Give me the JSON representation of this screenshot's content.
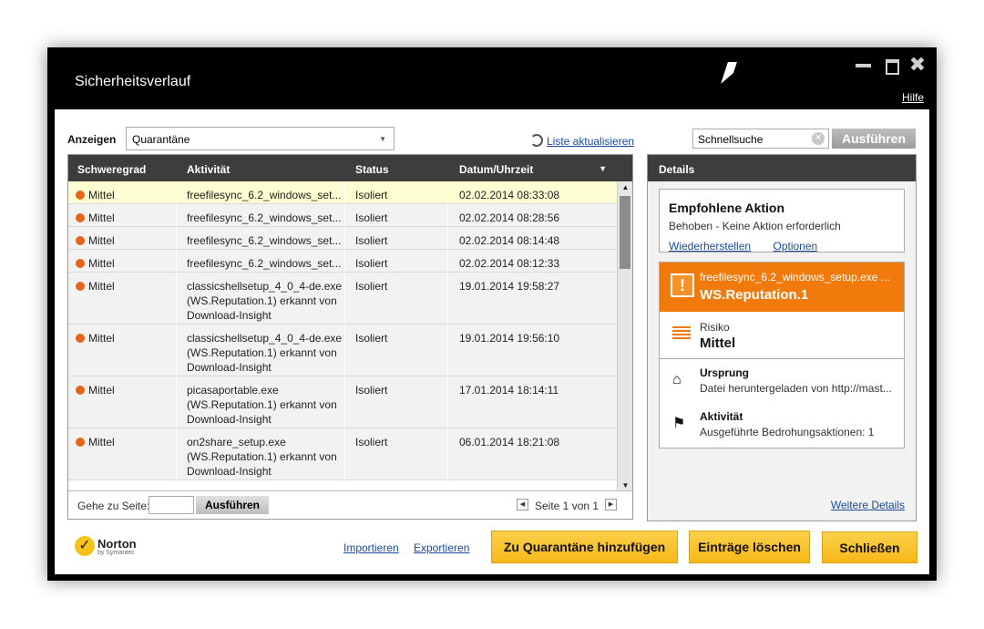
{
  "window": {
    "title": "Sicherheitsverlauf",
    "close_glyph": "✖",
    "help_label": "Hilfe"
  },
  "toolbar": {
    "show_label": "Anzeigen",
    "show_value": "Quarantäne",
    "dropdown_glyph": "▼",
    "refresh_label": "Liste aktualisieren",
    "search_placeholder": "Schnellsuche",
    "search_clear_glyph": "✕",
    "search_button": "Ausführen"
  },
  "table": {
    "columns": [
      "Schweregrad",
      "Aktivität",
      "Status",
      "Datum/Uhrzeit"
    ],
    "sort_glyph": "▼",
    "rows": [
      {
        "severity": "Mittel",
        "activity": [
          "freefilesync_6.2_windows_set..."
        ],
        "status": "Isoliert",
        "datetime": "02.02.2014 08:33:08"
      },
      {
        "severity": "Mittel",
        "activity": [
          "freefilesync_6.2_windows_set..."
        ],
        "status": "Isoliert",
        "datetime": "02.02.2014 08:28:56"
      },
      {
        "severity": "Mittel",
        "activity": [
          "freefilesync_6.2_windows_set..."
        ],
        "status": "Isoliert",
        "datetime": "02.02.2014 08:14:48"
      },
      {
        "severity": "Mittel",
        "activity": [
          "freefilesync_6.2_windows_set..."
        ],
        "status": "Isoliert",
        "datetime": "02.02.2014 08:12:33"
      },
      {
        "severity": "Mittel",
        "activity": [
          "classicshellsetup_4_0_4-de.exe",
          "(WS.Reputation.1) erkannt von",
          "Download-Insight"
        ],
        "status": "Isoliert",
        "datetime": "19.01.2014 19:58:27"
      },
      {
        "severity": "Mittel",
        "activity": [
          "classicshellsetup_4_0_4-de.exe",
          "(WS.Reputation.1) erkannt von",
          "Download-Insight"
        ],
        "status": "Isoliert",
        "datetime": "19.01.2014 19:56:10"
      },
      {
        "severity": "Mittel",
        "activity": [
          "picasaportable.exe",
          "(WS.Reputation.1) erkannt von",
          "Download-Insight"
        ],
        "status": "Isoliert",
        "datetime": "17.01.2014 18:14:11"
      },
      {
        "severity": "Mittel",
        "activity": [
          "on2share_setup.exe",
          "(WS.Reputation.1) erkannt von",
          "Download-Insight"
        ],
        "status": "Isoliert",
        "datetime": "06.01.2014 18:21:08"
      }
    ],
    "scroll_up_glyph": "▲",
    "scroll_down_glyph": "▼",
    "goto_label": "Gehe zu Seite:",
    "goto_button": "Ausführen",
    "prev_glyph": "◀",
    "next_glyph": "▶",
    "page_info": "Seite 1 von 1"
  },
  "details": {
    "header": "Details",
    "recommended_title": "Empfohlene Aktion",
    "recommended_text": "Behoben - Keine Aktion erforderlich",
    "restore_link": "Wiederherstellen",
    "options_link": "Optionen",
    "warn_glyph": "!",
    "threat_file": "freefilesync_6.2_windows_setup.exe ...",
    "threat_name": "WS.Reputation.1",
    "risk_label": "Risiko",
    "risk_value": "Mittel",
    "origin_glyph": "⌂",
    "origin_title": "Ursprung",
    "origin_text": "Datei heruntergeladen von http://mast...",
    "activity_glyph": "⚑",
    "activity_title": "Aktivität",
    "activity_text": "Ausgeführte Bedrohungsaktionen: 1",
    "more_link": "Weitere Details"
  },
  "footer": {
    "logo_check": "✓",
    "logo_name": "Norton",
    "logo_sub": "by Symantec",
    "import_link": "Importieren",
    "export_link": "Exportieren",
    "add_quarantine": "Zu Quarantäne hinzufügen",
    "delete_entries": "Einträge löschen",
    "close": "Schließen"
  },
  "colors": {
    "accent": "#f27a0c",
    "button": "#f7b818",
    "severity_dot": "#e8641a",
    "header_bg": "#3d3d3d"
  }
}
